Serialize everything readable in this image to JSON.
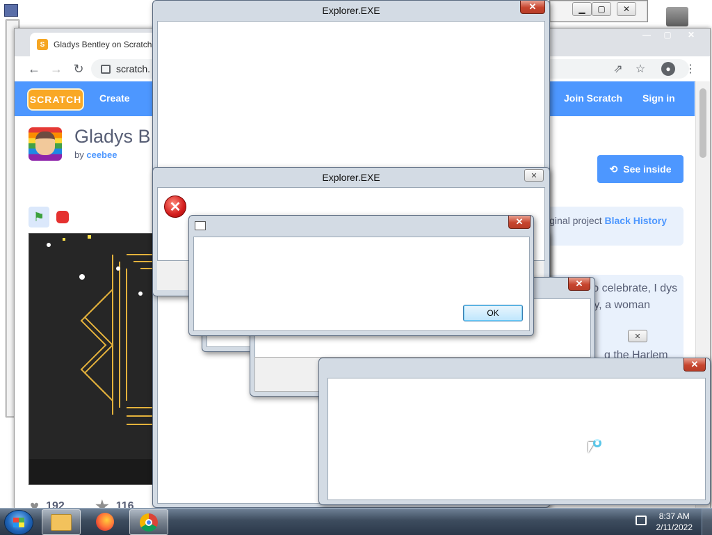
{
  "chrome": {
    "tab_title": "Gladys Bentley on Scratch",
    "url": "scratch."
  },
  "scratch": {
    "logo": "SCRATCH",
    "nav_create": "Create",
    "nav_join": "Join Scratch",
    "nav_signin": "Sign in",
    "project_title": "Gladys B",
    "by": "by",
    "author": "ceebee",
    "see_inside": "See inside",
    "remix_text": "iginal project",
    "remix_link": "Black History",
    "description": "one! To celebrate, I dys Bentley, a woman",
    "description_cut": "g the Harlem",
    "loves": "192",
    "favorites": "116"
  },
  "dialogs": {
    "explorer_title_1": "Explorer.EXE",
    "explorer_title_2": "Explorer.EXE",
    "ok": "OK"
  },
  "taskbar": {
    "time": "8:37 AM",
    "date": "2/11/2022"
  },
  "colors": {
    "scratch_blue": "#4d97ff",
    "close_red": "#c7452e"
  }
}
